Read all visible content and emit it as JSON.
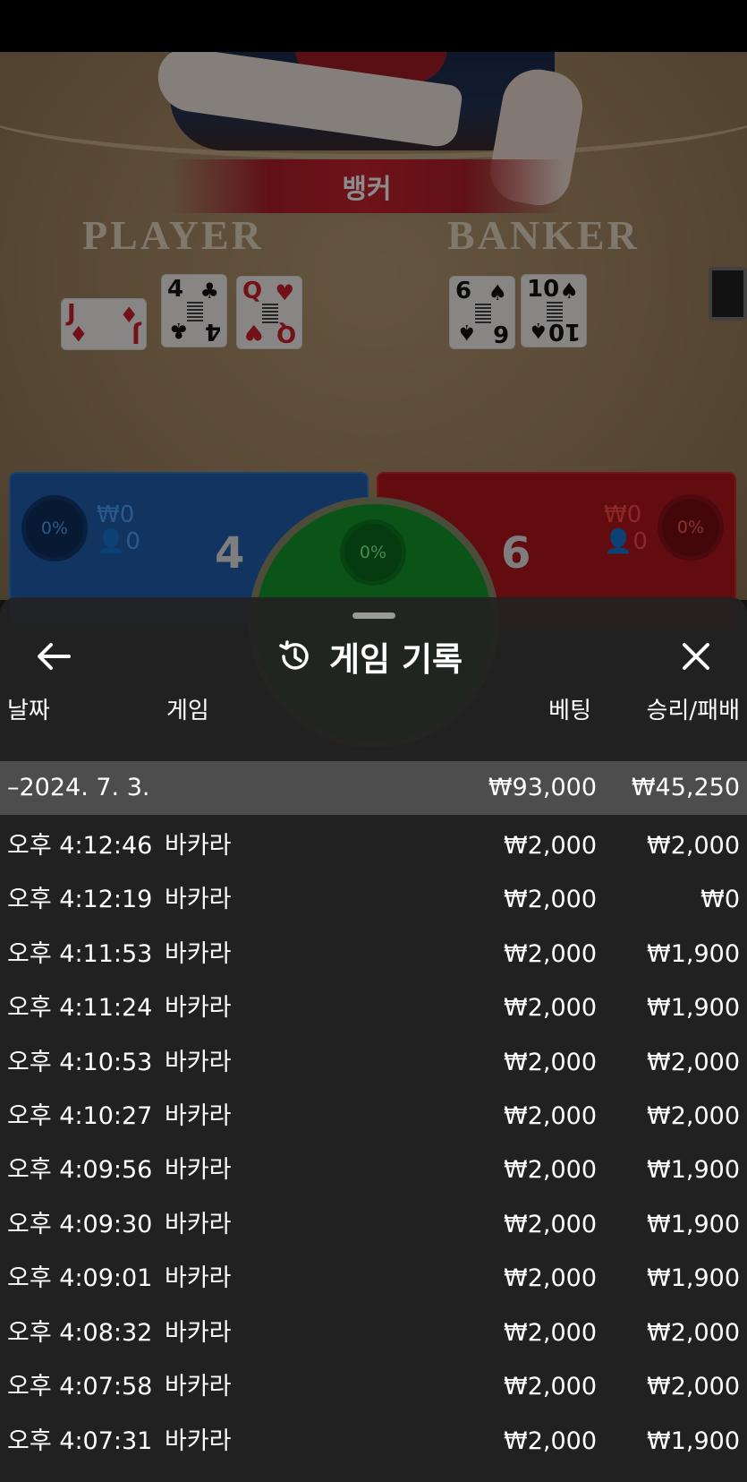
{
  "result_banner": "뱅커",
  "table": {
    "player_label": "PLAYER",
    "banker_label": "BANKER",
    "player_cards": [
      {
        "rank": "J",
        "suit": "♦",
        "color": "red"
      },
      {
        "rank": "4",
        "suit": "♣",
        "color": "black"
      },
      {
        "rank": "Q",
        "suit": "♥",
        "color": "red"
      }
    ],
    "banker_cards": [
      {
        "rank": "6",
        "suit": "♠",
        "color": "black"
      },
      {
        "rank": "10",
        "suit": "♠",
        "color": "black"
      }
    ]
  },
  "score_panel": {
    "player": {
      "percent": "0%",
      "amount": "₩0",
      "users": "0",
      "score": "4",
      "color": "#1f5fb0"
    },
    "tie": {
      "percent": "0%",
      "color": "#159a2a"
    },
    "banker": {
      "percent": "0%",
      "amount": "₩0",
      "users": "0",
      "score": "6",
      "color": "#b3161e"
    }
  },
  "history": {
    "title": "게임 기록",
    "back_icon": "arrow-left-icon",
    "history_icon": "history-clock-icon",
    "close_icon": "close-icon",
    "columns": {
      "date": "날짜",
      "game": "게임",
      "bet": "베팅",
      "result": "승리/패배"
    },
    "summary": {
      "date": "–2024. 7. 3.",
      "bet": "₩93,000",
      "result": "₩45,250"
    },
    "rows": [
      {
        "time": "오후 4:12:46",
        "game": "바카라",
        "bet": "₩2,000",
        "result": "₩2,000"
      },
      {
        "time": "오후 4:12:19",
        "game": "바카라",
        "bet": "₩2,000",
        "result": "₩0"
      },
      {
        "time": "오후 4:11:53",
        "game": "바카라",
        "bet": "₩2,000",
        "result": "₩1,900"
      },
      {
        "time": "오후 4:11:24",
        "game": "바카라",
        "bet": "₩2,000",
        "result": "₩1,900"
      },
      {
        "time": "오후 4:10:53",
        "game": "바카라",
        "bet": "₩2,000",
        "result": "₩2,000"
      },
      {
        "time": "오후 4:10:27",
        "game": "바카라",
        "bet": "₩2,000",
        "result": "₩2,000"
      },
      {
        "time": "오후 4:09:56",
        "game": "바카라",
        "bet": "₩2,000",
        "result": "₩1,900"
      },
      {
        "time": "오후 4:09:30",
        "game": "바카라",
        "bet": "₩2,000",
        "result": "₩1,900"
      },
      {
        "time": "오후 4:09:01",
        "game": "바카라",
        "bet": "₩2,000",
        "result": "₩1,900"
      },
      {
        "time": "오후 4:08:32",
        "game": "바카라",
        "bet": "₩2,000",
        "result": "₩2,000"
      },
      {
        "time": "오후 4:07:58",
        "game": "바카라",
        "bet": "₩2,000",
        "result": "₩2,000"
      },
      {
        "time": "오후 4:07:31",
        "game": "바카라",
        "bet": "₩2,000",
        "result": "₩1,900"
      }
    ]
  }
}
